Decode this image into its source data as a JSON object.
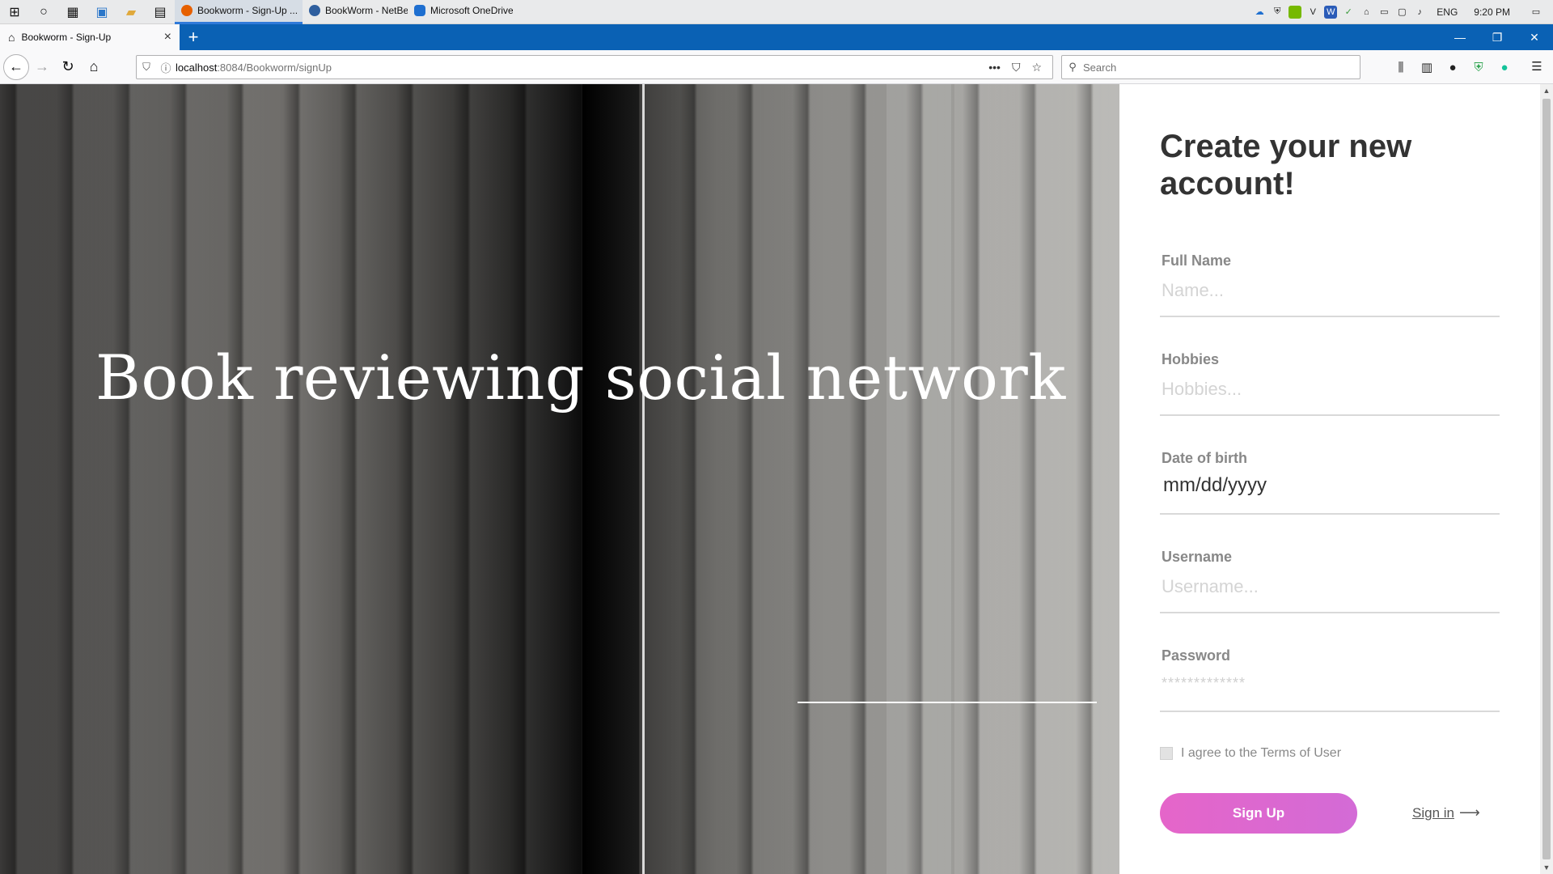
{
  "taskbar": {
    "tasks": [
      {
        "label": "Bookworm - Sign-Up ...",
        "color": "#e66000",
        "active": true
      },
      {
        "label": "BookWorm - NetBea...",
        "color": "#2f5f9e",
        "active": false
      },
      {
        "label": "Microsoft OneDrive",
        "color": "#1e6fd0",
        "active": false
      }
    ],
    "tray": {
      "language": "ENG",
      "time": "9:20 PM"
    }
  },
  "browser": {
    "tab_title": "Bookworm - Sign-Up",
    "url_host": "localhost",
    "url_rest": ":8084/Bookworm/signUp",
    "search_placeholder": "Search",
    "accent": "#0a61b4"
  },
  "hero": {
    "title": "Book reviewing social network"
  },
  "form": {
    "title": "Create your new account!",
    "fields": [
      {
        "label": "Full Name",
        "placeholder": "Name..."
      },
      {
        "label": "Hobbies",
        "placeholder": "Hobbies..."
      },
      {
        "label": "Date of birth",
        "value": "mm/dd/yyyy"
      },
      {
        "label": "Username",
        "placeholder": "Username..."
      },
      {
        "label": "Password",
        "value": "*************"
      }
    ],
    "agree_label": "I agree to the Terms of User",
    "signup_label": "Sign Up",
    "signin_label": "Sign in",
    "button_gradient": [
      "#e565c9",
      "#d36bd6"
    ]
  }
}
